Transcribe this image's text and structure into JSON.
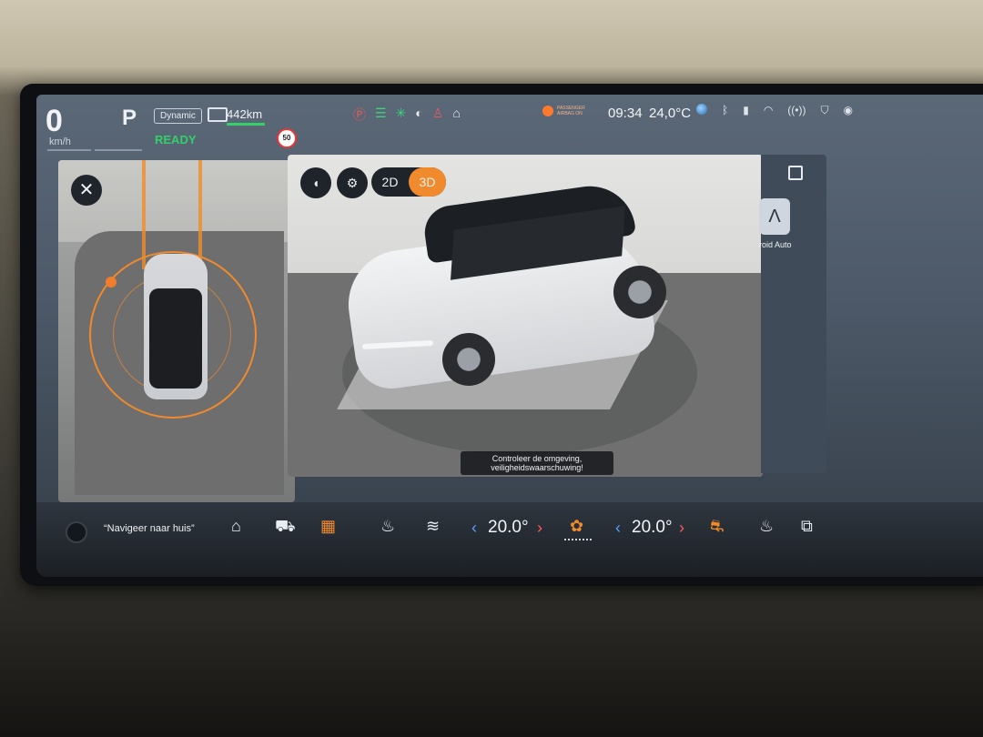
{
  "status": {
    "speed": "0",
    "speed_unit": "km/h",
    "gear": "P",
    "drive_mode": "Dynamic",
    "ready": "READY",
    "range": "442km",
    "speed_limit": "50",
    "airbag_text": "PASSENGER AIRBAG ON",
    "time": "09:34",
    "outside_temp": "24,0°C"
  },
  "camera": {
    "mode_2d": "2D",
    "mode_3d": "3D",
    "active_mode": "3D",
    "notice": "Controleer de omgeving, veiligheidswaarschuwing!"
  },
  "side_panel": {
    "app_label": "roid Auto"
  },
  "dock": {
    "voice_prompt": "“Navigeer naar huis”",
    "driver_temp": "20.0°",
    "passenger_temp": "20.0°"
  },
  "colors": {
    "accent": "#f08a2c",
    "ready_green": "#33d06a",
    "temp_left_arrow": "#5aa0ff",
    "temp_right_arrow": "#ff5a5a"
  }
}
